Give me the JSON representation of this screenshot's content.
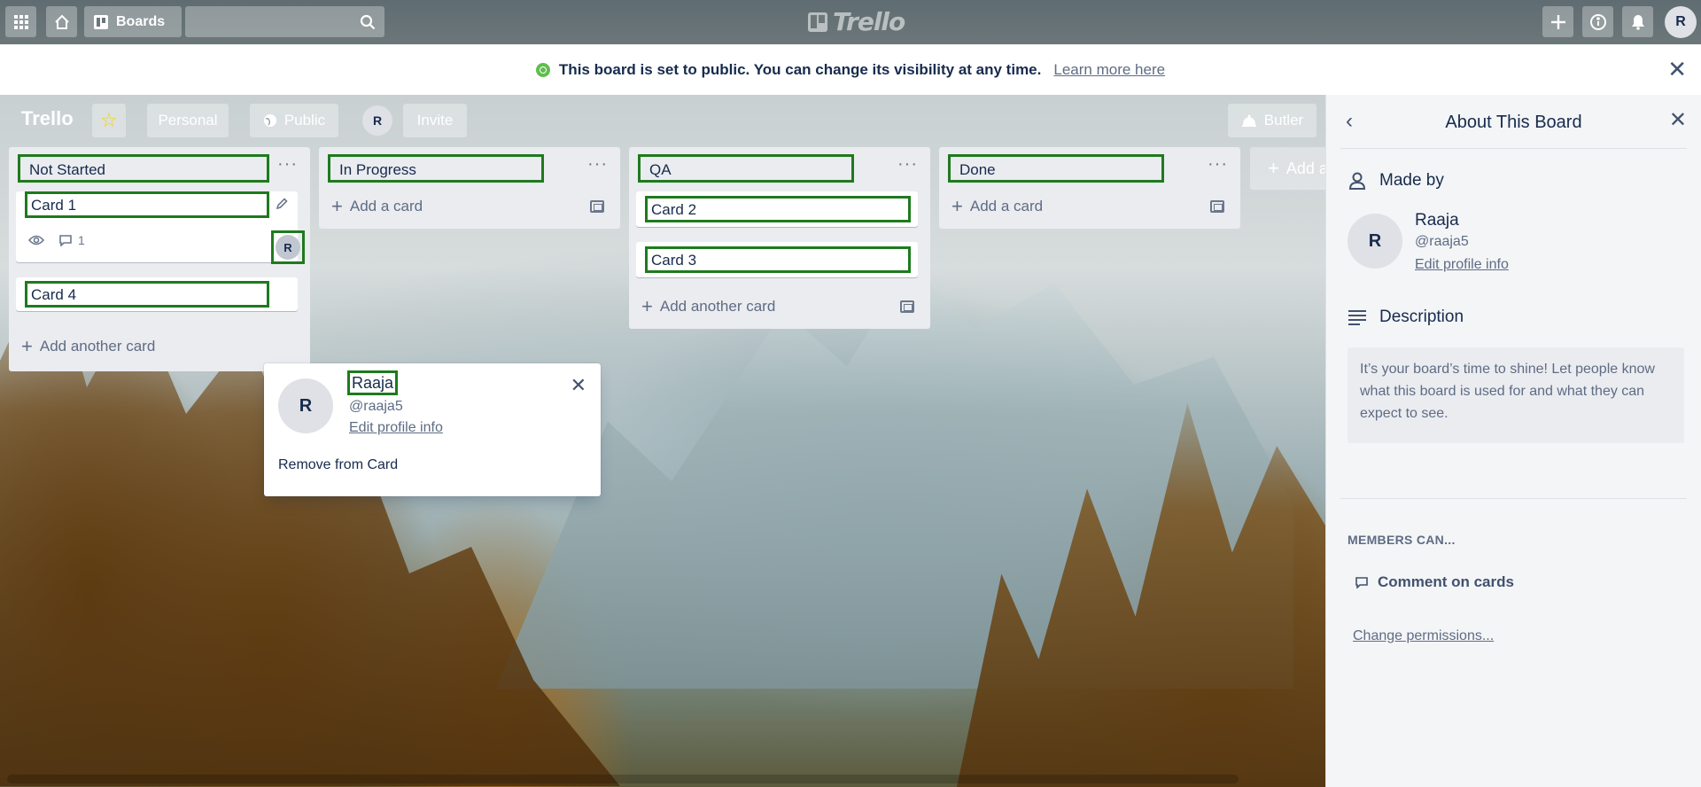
{
  "header": {
    "boards_label": "Boards",
    "logo_text": "Trello",
    "avatar_initial": "R"
  },
  "notice": {
    "message": "This board is set to public. You can change its visibility at any time.",
    "link": "Learn more here"
  },
  "board": {
    "title": "Trello",
    "personal_label": "Personal",
    "public_label": "Public",
    "member_initial": "R",
    "invite_label": "Invite",
    "butler_label": "Butler",
    "add_list_label": "Add a",
    "lists": [
      {
        "name": "Not Started",
        "cards": [
          {
            "title": "Card 1",
            "comments": "1",
            "member": "R"
          },
          {
            "title": "Card 4"
          }
        ],
        "add_label": "Add another card"
      },
      {
        "name": "In Progress",
        "cards": [],
        "add_label": "Add a card"
      },
      {
        "name": "QA",
        "cards": [
          {
            "title": "Card 2"
          },
          {
            "title": "Card 3"
          }
        ],
        "add_label": "Add another card"
      },
      {
        "name": "Done",
        "cards": [],
        "add_label": "Add a card"
      }
    ]
  },
  "popover": {
    "initial": "R",
    "name": "Raaja",
    "handle": "@raaja5",
    "edit_link": "Edit profile info",
    "remove_label": "Remove from Card"
  },
  "sidebar": {
    "title": "About This Board",
    "made_by_label": "Made by",
    "owner_initial": "R",
    "owner_name": "Raaja",
    "owner_handle": "@raaja5",
    "edit_link": "Edit profile info",
    "description_label": "Description",
    "description_text": "It’s your board’s time to shine! Let people know what this board is used for and what they can expect to see.",
    "members_can_label": "MEMBERS CAN...",
    "permission_label": "Comment on cards",
    "change_link": "Change permissions..."
  }
}
